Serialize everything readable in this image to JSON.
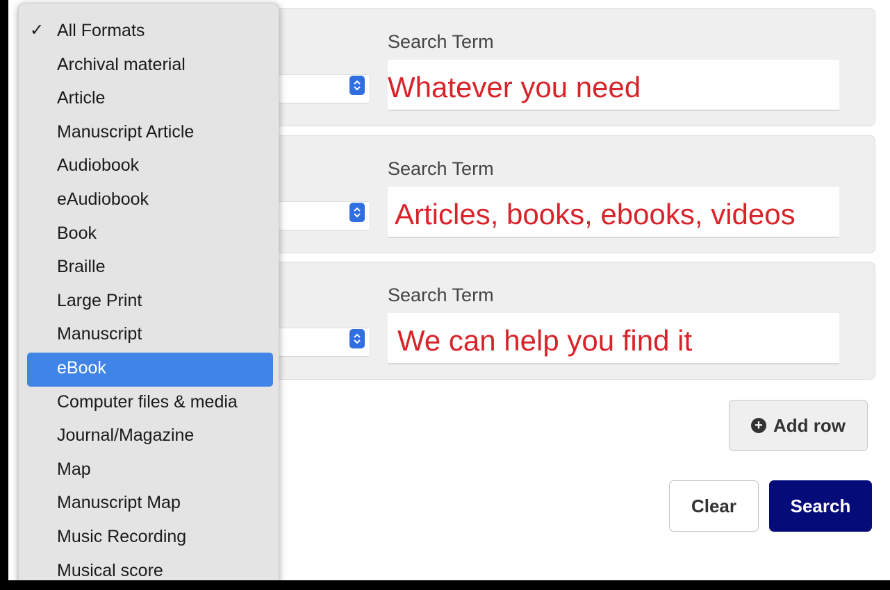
{
  "rows": [
    {
      "label": "Search Term",
      "value": "Whatever you need"
    },
    {
      "label": "Search Term",
      "value": "Articles, books, ebooks, videos"
    },
    {
      "label": "Search Term",
      "value": "We can help you find it"
    }
  ],
  "buttons": {
    "add_row": "Add row",
    "clear": "Clear",
    "search": "Search"
  },
  "menu": {
    "check_glyph": "✓",
    "items": [
      {
        "label": "All Formats",
        "checked": true
      },
      {
        "label": "Archival material"
      },
      {
        "label": "Article"
      },
      {
        "label": "Manuscript Article"
      },
      {
        "label": "Audiobook"
      },
      {
        "label": "eAudiobook"
      },
      {
        "label": "Book"
      },
      {
        "label": "Braille"
      },
      {
        "label": "Large Print"
      },
      {
        "label": "Manuscript"
      },
      {
        "label": "eBook",
        "highlighted": true
      },
      {
        "label": "Computer files & media"
      },
      {
        "label": "Journal/Magazine"
      },
      {
        "label": "Map"
      },
      {
        "label": "Manuscript Map"
      },
      {
        "label": "Music Recording"
      },
      {
        "label": "Musical score"
      }
    ]
  },
  "colors": {
    "search_text": "#d8232a",
    "search_button": "#060b7a",
    "highlight": "#3f84e6",
    "select_arrow": "#2f6fe0"
  }
}
